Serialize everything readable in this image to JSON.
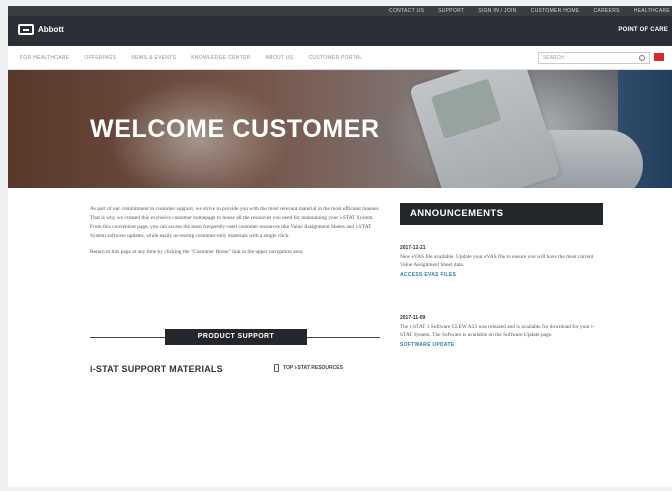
{
  "topbar": {
    "links": [
      "CONTACT US",
      "SUPPORT",
      "SIGN IN / JOIN",
      "CUSTOMER HOME",
      "CAREERS",
      "HEALTHCARE"
    ]
  },
  "brand": {
    "logo_text": "Abbott",
    "section": "POINT OF CARE"
  },
  "nav": {
    "items": [
      "FOR HEALTHCARE",
      "OFFERINGS",
      "NEWS & EVENTS",
      "KNOWLEDGE CENTER",
      "ABOUT US",
      "CUSTOMER PORTAL"
    ],
    "search_placeholder": "SEARCH"
  },
  "hero": {
    "title": "WELCOME CUSTOMER"
  },
  "intro": {
    "p1": "As part of our commitment to customer support, we strive to provide you with the most relevant material in the most efficient manner. That is why we created this exclusive customer homepage to house all the resources you need for maintaining your i-STAT System. From this convenient page, you can access the most frequently-used customer resources like Value Assignment Sheets and i-STAT System software updates, while easily accessing customer-only materials with a single click.",
    "p2": "Return to this page at any time by clicking the \"Customer Home\" link in the upper navigation area."
  },
  "product_support": {
    "label": "PRODUCT SUPPORT"
  },
  "materials": {
    "title": "i-STAT SUPPORT MATERIALS",
    "resources_label": "TOP i-STAT RESOURCES"
  },
  "announcements": {
    "title": "ANNOUNCEMENTS",
    "items": [
      {
        "date": "2017-12-21",
        "text": "New eVAS file available. Update your eVAS file to ensure you will have the most current Value Assignment Sheet data.",
        "link": "ACCESS EVAS FILES"
      },
      {
        "date": "2017-11-09",
        "text": "The i-STAT 1 Software CLEW A33 was released and is available for download for your i-STAT System. The Software is available on the Software Update page.",
        "link": "SOFTWARE UPDATE"
      }
    ]
  }
}
